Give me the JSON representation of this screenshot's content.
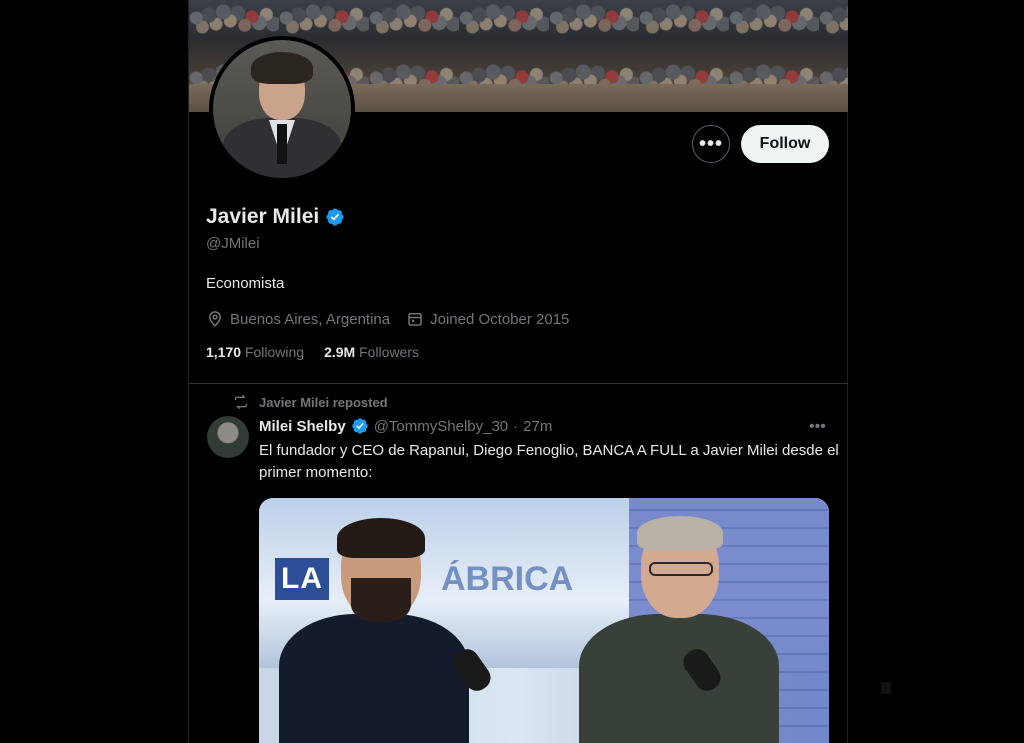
{
  "profile": {
    "display_name": "Javier Milei",
    "handle": "@JMilei",
    "bio": "Economista",
    "location": "Buenos Aires, Argentina",
    "joined": "Joined October 2015",
    "following_count": "1,170",
    "following_label": "Following",
    "followers_count": "2.9M",
    "followers_label": "Followers",
    "verified_color": "#1d9bf0"
  },
  "actions": {
    "more_label": "•••",
    "follow_label": "Follow"
  },
  "post": {
    "repost_label": "Javier Milei reposted",
    "author_name": "Milei Shelby",
    "author_handle": "@TommyShelby_30",
    "separator": "·",
    "time": "27m",
    "more_label": "•••",
    "text": "El fundador y CEO de Rapanui, Diego Fenoglio, BANCA A FULL a Javier Milei desde el primer momento:",
    "media_logo_left": "LA",
    "media_logo_right": "ÁBRICA"
  }
}
